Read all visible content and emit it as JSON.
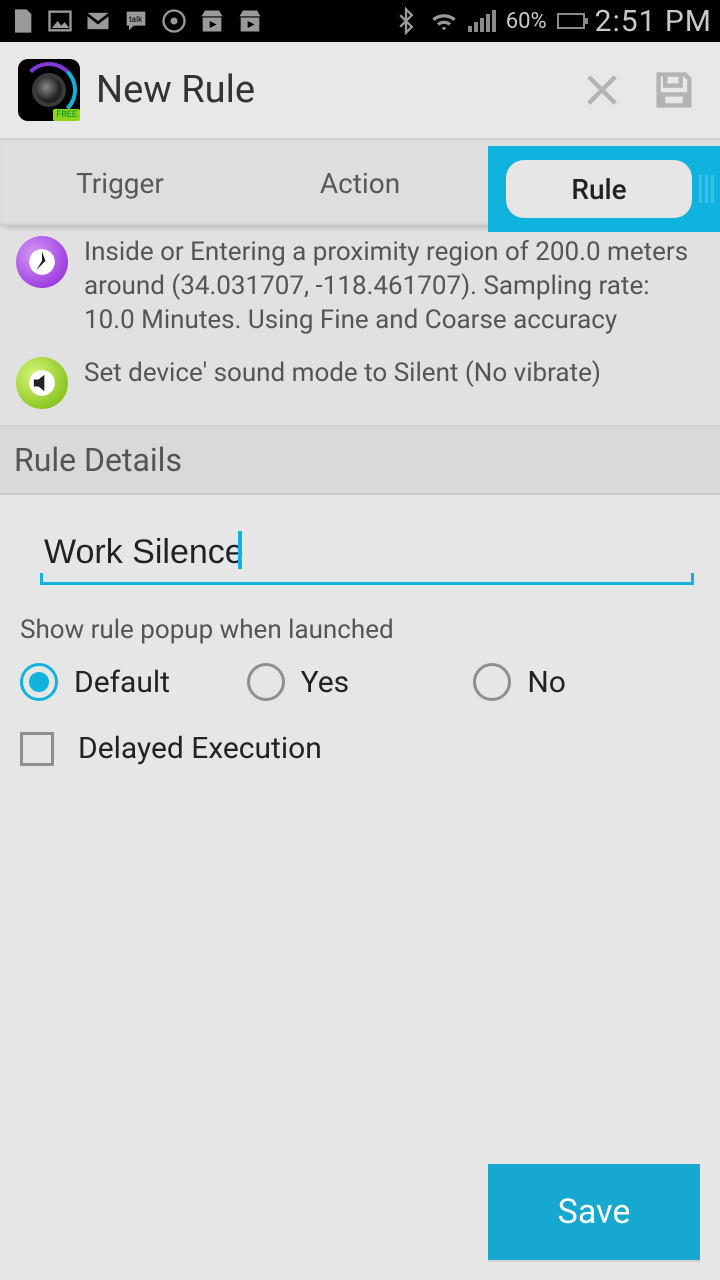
{
  "statusbar": {
    "battery_text": "60%",
    "time": "2:51 PM"
  },
  "actionbar": {
    "title": "New Rule"
  },
  "tabs": {
    "trigger": "Trigger",
    "action": "Action",
    "rule": "Rule"
  },
  "summary": {
    "trigger_text": "Inside or Entering a proximity region of 200.0 meters around (34.031707, -118.461707). Sampling rate: 10.0 Minutes. Using Fine and Coarse accuracy",
    "action_text": "Set device' sound mode to Silent (No vibrate)"
  },
  "section": {
    "rule_details": "Rule Details"
  },
  "form": {
    "rule_name": "Work Silence",
    "popup_label": "Show rule popup when launched",
    "opt_default": "Default",
    "opt_yes": "Yes",
    "opt_no": "No",
    "delayed": "Delayed Execution"
  },
  "footer": {
    "save": "Save"
  }
}
